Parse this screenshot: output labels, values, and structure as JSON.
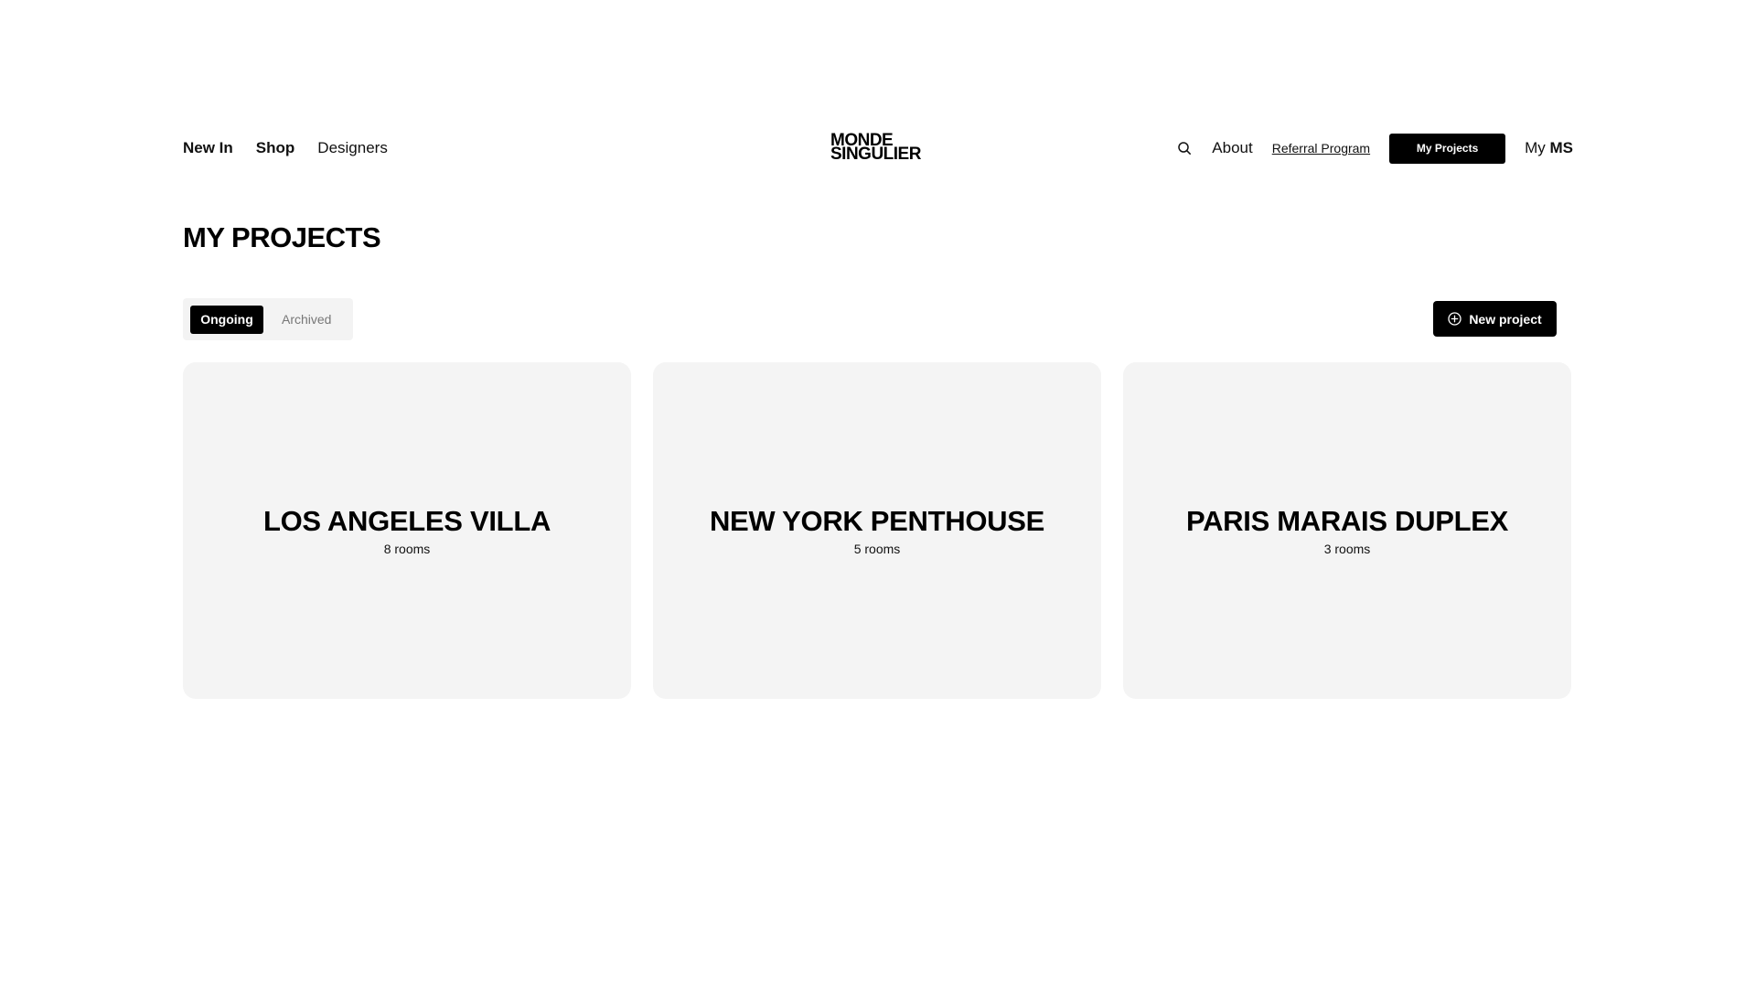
{
  "header": {
    "nav_left": [
      {
        "label": "New In"
      },
      {
        "label": "Shop"
      },
      {
        "label": "Designers"
      }
    ],
    "logo": {
      "line1": "MONDE",
      "line2": "SINGULIER"
    },
    "search_icon": "search-icon",
    "about_label": "About",
    "referral_label": "Referral Program",
    "my_projects_label": "My Projects",
    "account": {
      "prefix": "My",
      "initials": "MS"
    }
  },
  "main": {
    "title": "MY PROJECTS",
    "tabs": [
      {
        "label": "Ongoing",
        "active": true
      },
      {
        "label": "Archived",
        "active": false
      }
    ],
    "new_project": {
      "icon": "plus-circle-icon",
      "label": "New project"
    },
    "projects": [
      {
        "title": "LOS ANGELES VILLA",
        "rooms": "8 rooms"
      },
      {
        "title": "NEW YORK PENTHOUSE",
        "rooms": "5 rooms"
      },
      {
        "title": "PARIS MARAIS DUPLEX",
        "rooms": "3 rooms"
      }
    ]
  },
  "colors": {
    "background": "#ffffff",
    "primary": "#000000",
    "card_background": "#f4f4f4",
    "tab_background": "#f3f3f3",
    "muted_text": "#777777"
  }
}
